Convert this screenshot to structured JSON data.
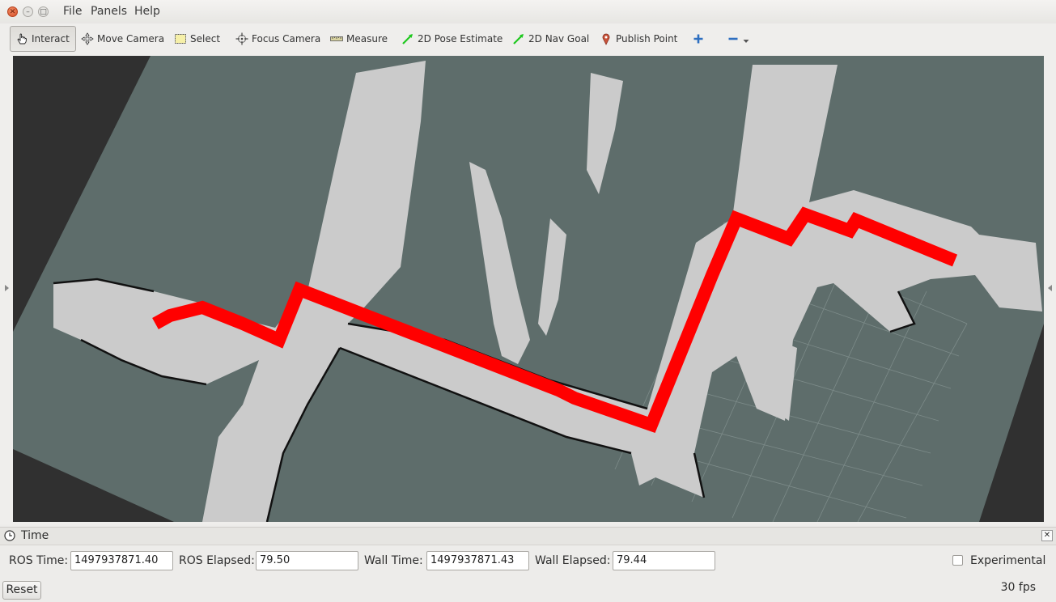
{
  "menu": {
    "file": "File",
    "panels": "Panels",
    "help": "Help"
  },
  "toolbar": {
    "interact": "Interact",
    "move_camera": "Move Camera",
    "select": "Select",
    "focus_camera": "Focus Camera",
    "measure": "Measure",
    "pose_estimate": "2D Pose Estimate",
    "nav_goal": "2D Nav Goal",
    "publish_point": "Publish Point"
  },
  "colors": {
    "path": "#ff0000",
    "free_space": "#cbcbcb",
    "unknown": "#5e6d6b",
    "background": "#303030"
  },
  "time_panel": {
    "title": "Time",
    "ros_time_label": "ROS Time:",
    "ros_time": "1497937871.40",
    "ros_elapsed_label": "ROS Elapsed:",
    "ros_elapsed": "79.50",
    "wall_time_label": "Wall Time:",
    "wall_time": "1497937871.43",
    "wall_elapsed_label": "Wall Elapsed:",
    "wall_elapsed": "79.44",
    "experimental_label": "Experimental"
  },
  "status": {
    "reset": "Reset",
    "fps": "30 fps"
  }
}
